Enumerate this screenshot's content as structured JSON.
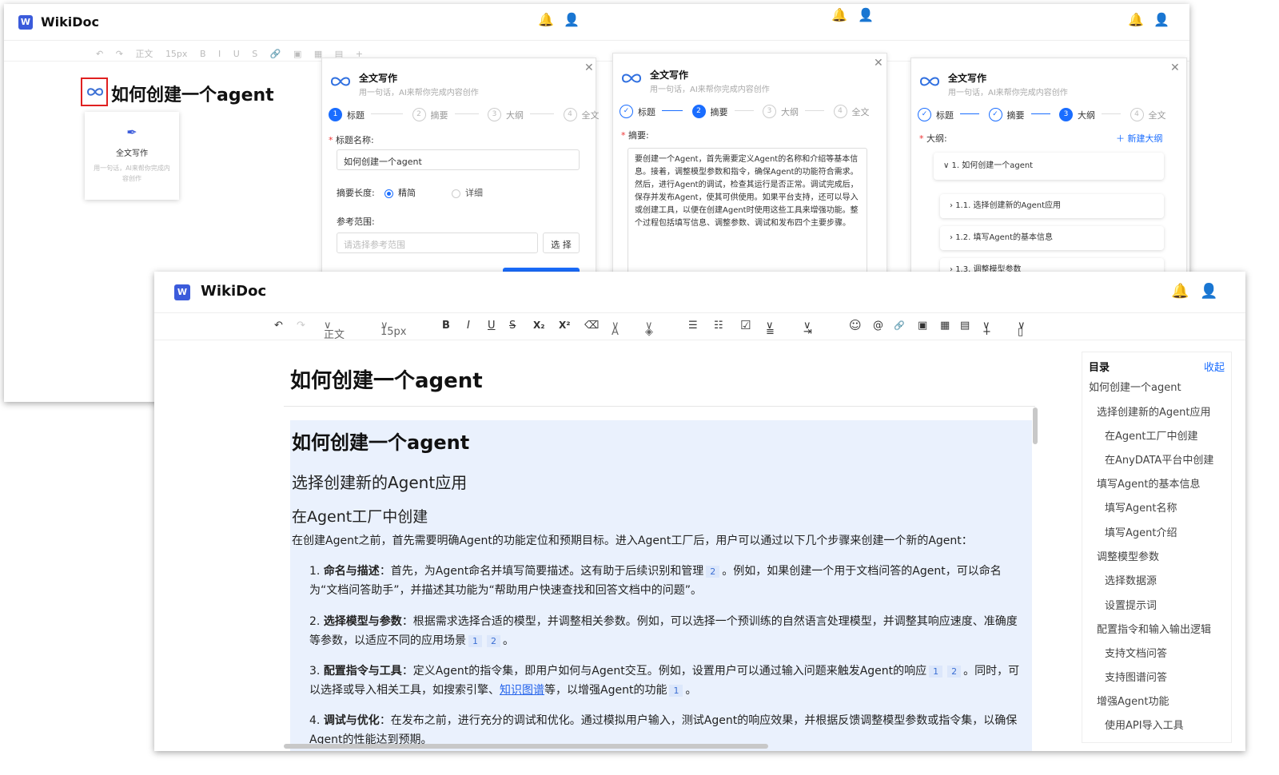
{
  "app": {
    "name": "WikiDoc",
    "logo_letter": "W"
  },
  "bg_toolbar": {
    "items": [
      "↶",
      "↷",
      "正文",
      "15px",
      "B",
      "I",
      "U",
      "S",
      "🔗",
      "▣",
      "▦",
      "▤",
      "+"
    ]
  },
  "bg_doc": {
    "title": "如何创建一个agent",
    "popup": {
      "label": "全文写作",
      "desc": "用一句话，AI来帮你完成内容创作"
    }
  },
  "panel": {
    "title": "全文写作",
    "subtitle": "用一句话，AI来帮你完成内容创作",
    "steps": [
      {
        "num": "1",
        "label": "标题"
      },
      {
        "num": "2",
        "label": "摘要"
      },
      {
        "num": "3",
        "label": "大纲"
      },
      {
        "num": "4",
        "label": "全文"
      }
    ]
  },
  "panel1": {
    "title_label": "标题名称:",
    "title_value": "如何创建一个agent",
    "length_label": "摘要长度:",
    "opt_brief": "精简",
    "opt_detail": "详细",
    "scope_label": "参考范围:",
    "scope_placeholder": "请选择参考范围",
    "select_btn": "选 择"
  },
  "panel2": {
    "summary_label": "摘要:",
    "summary_text": "要创建一个Agent，首先需要定义Agent的名称和介绍等基本信息。接着，调整模型参数和指令，确保Agent的功能符合需求。然后，进行Agent的调试，检查其运行是否正常。调试完成后，保存并发布Agent，使其可供使用。如果平台支持，还可以导入或创建工具，以便在创建Agent时使用这些工具来增强功能。整个过程包括填写信息、调整参数、调试和发布四个主要步骤。"
  },
  "panel3": {
    "outline_label": "大纲:",
    "new_outline": "新建大纲",
    "items": [
      "1. 如何创建一个agent",
      "1.1. 选择创建新的Agent应用",
      "1.2. 填写Agent的基本信息",
      "1.3. 调整模型参数"
    ]
  },
  "main": {
    "toolbar": {
      "undo": "↶",
      "redo": "↷",
      "style": "正文",
      "size": "15px",
      "bold": "B",
      "italic": "I",
      "underline": "U",
      "strike": "S",
      "sub": "X₂",
      "sup": "X²",
      "eraser": "⌫",
      "fontcolor": "A",
      "bgcolor": "◈",
      "ul": "☰",
      "ol": "☷",
      "check": "☑",
      "align": "≡",
      "indent": "⇥",
      "emoji": "☺",
      "at": "@",
      "link": "🔗",
      "image": "▣",
      "table": "▦",
      "code": "▤",
      "plus": "+",
      "more": "▯"
    },
    "doc_title": "如何创建一个agent",
    "content": {
      "h1": "如何创建一个agent",
      "h2": "选择创建新的Agent应用",
      "h3": "在Agent工厂中创建",
      "intro": "在创建Agent之前，首先需要明确Agent的功能定位和预期目标。进入Agent工厂后，用户可以通过以下几个步骤来创建一个新的Agent：",
      "items": [
        {
          "num": "1.",
          "head": "命名与描述",
          "text": "：首先，为Agent命名并填写简要描述。这有助于后续识别和管理",
          "c1": "2",
          "text2": "。例如，如果创建一个用于文档问答的Agent，可以命名为“文档问答助手”，并描述其功能为“帮助用户快速查找和回答文档中的问题”。"
        },
        {
          "num": "2.",
          "head": "选择模型与参数",
          "text": "：根据需求选择合适的模型，并调整相关参数。例如，可以选择一个预训练的自然语言处理模型，并调整其响应速度、准确度等参数，以适应不同的应用场景",
          "c1": "1",
          "c2": "2",
          "text2": "。"
        },
        {
          "num": "3.",
          "head": "配置指令与工具",
          "text": "：定义Agent的指令集，即用户如何与Agent交互。例如，设置用户可以通过输入问题来触发Agent的响应",
          "c1": "1",
          "c2": "2",
          "text2": "。同时，可以选择或导入相关工具，如搜索引擎、",
          "link": "知识图谱",
          "text3": "等，以增强Agent的功能",
          "c3": "1",
          "text4": "。"
        },
        {
          "num": "4.",
          "head": "调试与优化",
          "text": "：在发布之前，进行充分的调试和优化。通过模拟用户输入，测试Agent的响应效果，并根据反馈调整模型参数或指令集，以确保Agent的性能达到预期。"
        }
      ]
    },
    "toc": {
      "title": "目录",
      "collapse": "收起",
      "items": [
        "如何创建一个agent",
        "选择创建新的Agent应用",
        "在Agent工厂中创建",
        "在AnyDATA平台中创建",
        "填写Agent的基本信息",
        "填写Agent名称",
        "填写Agent介绍",
        "调整模型参数",
        "选择数据源",
        "设置提示词",
        "配置指令和输入输出逻辑",
        "支持文档问答",
        "支持图谱问答",
        "增强Agent功能",
        "使用API导入工具"
      ]
    }
  },
  "colors": {
    "accent": "#1a6dff",
    "brand": "#3b5bdb",
    "highlight": "#eaf1fd",
    "annotation": "#e02020"
  }
}
